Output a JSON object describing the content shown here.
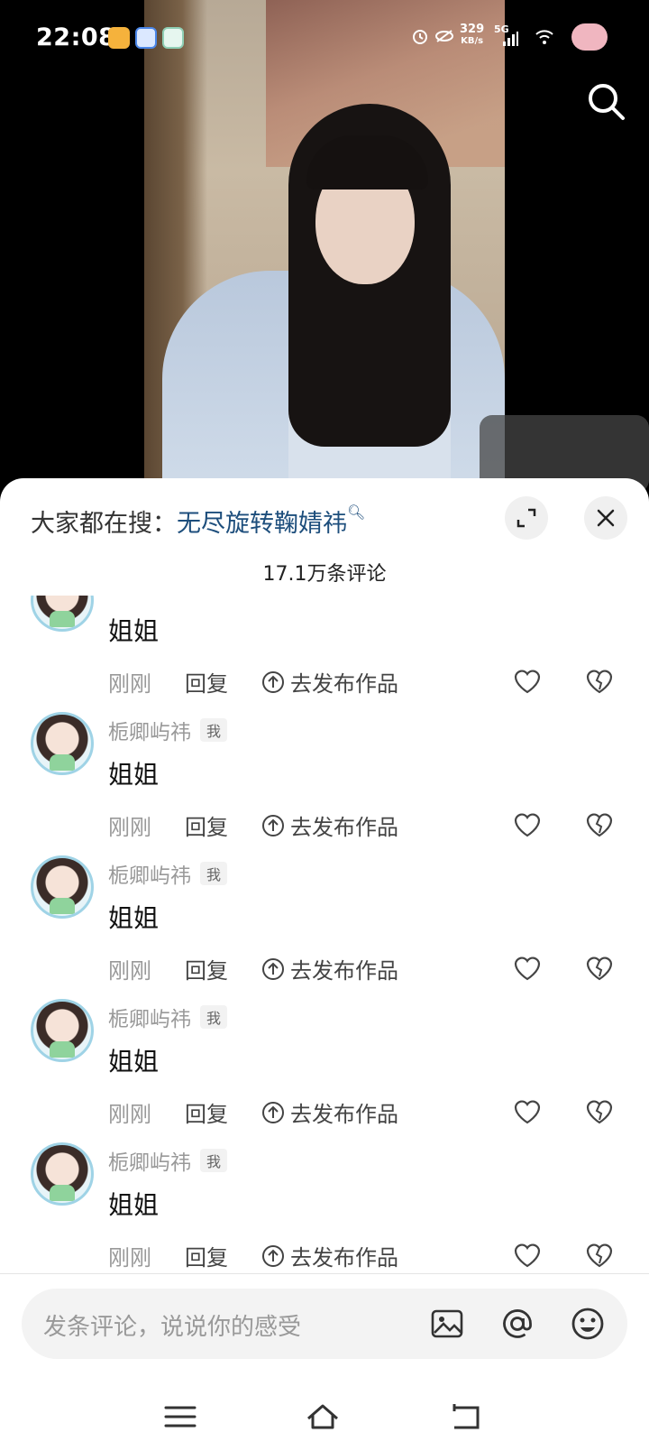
{
  "status_bar": {
    "time": "22:08",
    "net_speed": "329",
    "net_unit": "KB/s",
    "network": "5G"
  },
  "sheet": {
    "search_prefix": "大家都在搜：",
    "search_keyword": "无尽旋转鞠婧祎",
    "comment_count": "17.1万条评论"
  },
  "comments": [
    {
      "user": "",
      "tag": "",
      "text": "姐姐",
      "time": "刚刚",
      "reply": "回复",
      "post": "去发布作品"
    },
    {
      "user": "栀卿屿祎",
      "tag": "我",
      "text": "姐姐",
      "time": "刚刚",
      "reply": "回复",
      "post": "去发布作品"
    },
    {
      "user": "栀卿屿祎",
      "tag": "我",
      "text": "姐姐",
      "time": "刚刚",
      "reply": "回复",
      "post": "去发布作品"
    },
    {
      "user": "栀卿屿祎",
      "tag": "我",
      "text": "姐姐",
      "time": "刚刚",
      "reply": "回复",
      "post": "去发布作品"
    },
    {
      "user": "栀卿屿祎",
      "tag": "我",
      "text": "姐姐",
      "time": "刚刚",
      "reply": "回复",
      "post": "去发布作品"
    }
  ],
  "input": {
    "placeholder": "发条评论，说说你的感受"
  },
  "icons": {
    "top_right": "search-icon",
    "sheet_buttons": [
      "expand-icon",
      "close-icon"
    ],
    "comment_actions": [
      "upload-circle-icon",
      "heart-icon",
      "broken-heart-icon"
    ],
    "input_actions": [
      "image-icon",
      "at-icon",
      "emoji-icon"
    ],
    "nav": [
      "menu-icon",
      "home-icon",
      "back-icon"
    ]
  },
  "colors": {
    "keyword": "#1d4e7c",
    "avatar_ring": "#9fd3e6"
  }
}
